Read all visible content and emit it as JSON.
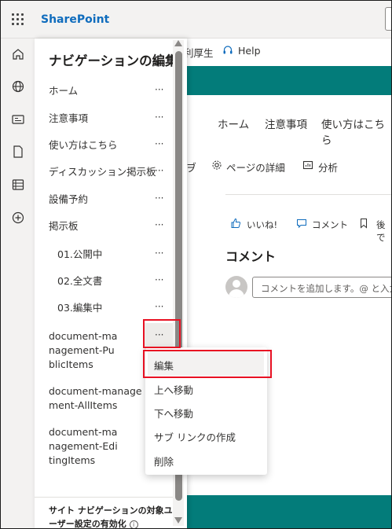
{
  "app": {
    "brand": "SharePoint"
  },
  "header": {
    "user_fragment": "利厚生",
    "help_label": "Help"
  },
  "hub_nav": [
    "ホーム",
    "注意事項",
    "使い方はこちら"
  ],
  "command_bar": {
    "tail_fragment": "ヺ",
    "page_details": "ページの詳細",
    "analytics": "分析"
  },
  "social": {
    "like": "いいね!",
    "comment": "コメント",
    "save_fragment": "後で"
  },
  "comments": {
    "heading": "コメント",
    "placeholder": "コメントを追加します。@ と入力して"
  },
  "nav_panel": {
    "title": "ナビゲーションの編集",
    "more_label": "···",
    "items": [
      {
        "label": "ホーム"
      },
      {
        "label": "注意事項"
      },
      {
        "label": "使い方はこちら"
      },
      {
        "label": "ディスカッション掲示板"
      },
      {
        "label": "設備予約"
      },
      {
        "label": "掲示板"
      },
      {
        "label": "01.公開中"
      },
      {
        "label": "02.全文書"
      },
      {
        "label": "03.編集中"
      },
      {
        "label": "document-management-PublicItems"
      },
      {
        "label": "document-management-AllItems"
      },
      {
        "label": "document-management-EditingItems"
      }
    ],
    "footer": "サイト ナビゲーションの対象ユーザー設定の有効化"
  },
  "context_menu": {
    "items": [
      "編集",
      "上へ移動",
      "下へ移動",
      "サブ リンクの作成",
      "削除"
    ]
  },
  "colors": {
    "brand": "#0f6cbd",
    "teal": "#037c7a",
    "highlight": "#e81123"
  }
}
